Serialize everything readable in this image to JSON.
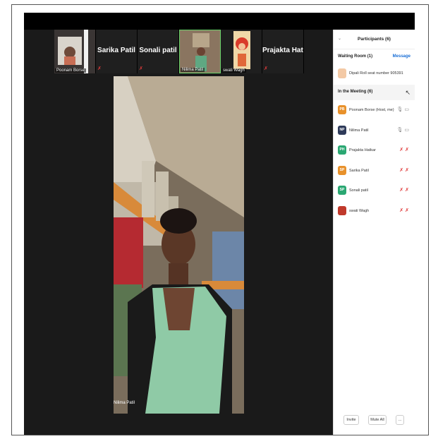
{
  "tiles": [
    {
      "name": "Poonam Borse",
      "kind": "video"
    },
    {
      "name": "Sarika Patil",
      "kind": "name"
    },
    {
      "name": "Sonali patil",
      "kind": "name"
    },
    {
      "name": "Nilima Patil",
      "kind": "video",
      "active": true
    },
    {
      "name": "swati Wagh",
      "kind": "video"
    },
    {
      "name": "Prajakta Hatkar",
      "kind": "name"
    }
  ],
  "speaker": {
    "name": "Nilima Patil"
  },
  "panel": {
    "title": "Participants (6)",
    "waiting_label": "Waiting Room (1)",
    "message_label": "Message",
    "waiting_person": "Dipali Roll seat number 905391",
    "meeting_label": "In the Meeting (6)",
    "participants": [
      {
        "initials": "PB",
        "name": "Poonam Borse (Host, me)",
        "color": "#e8912b",
        "audio": "on"
      },
      {
        "initials": "NP",
        "name": "Nilima Patil",
        "color": "#2e3a59",
        "audio": "on"
      },
      {
        "initials": "PH",
        "name": "Prajakta Hatkar",
        "color": "#2aa772",
        "audio": "off"
      },
      {
        "initials": "SP",
        "name": "Sarika Patil",
        "color": "#e8912b",
        "audio": "off"
      },
      {
        "initials": "SP",
        "name": "Sonali patil",
        "color": "#2aa772",
        "audio": "off"
      },
      {
        "initials": "",
        "name": "swati Wagh",
        "color": "#c0392b",
        "audio": "off"
      }
    ],
    "invite_label": "Invite",
    "mute_all_label": "Mute All",
    "more_label": "..."
  },
  "colors": {
    "active_border": "#6ad46a",
    "muted": "#e03b3b",
    "link": "#1a6fd6"
  }
}
